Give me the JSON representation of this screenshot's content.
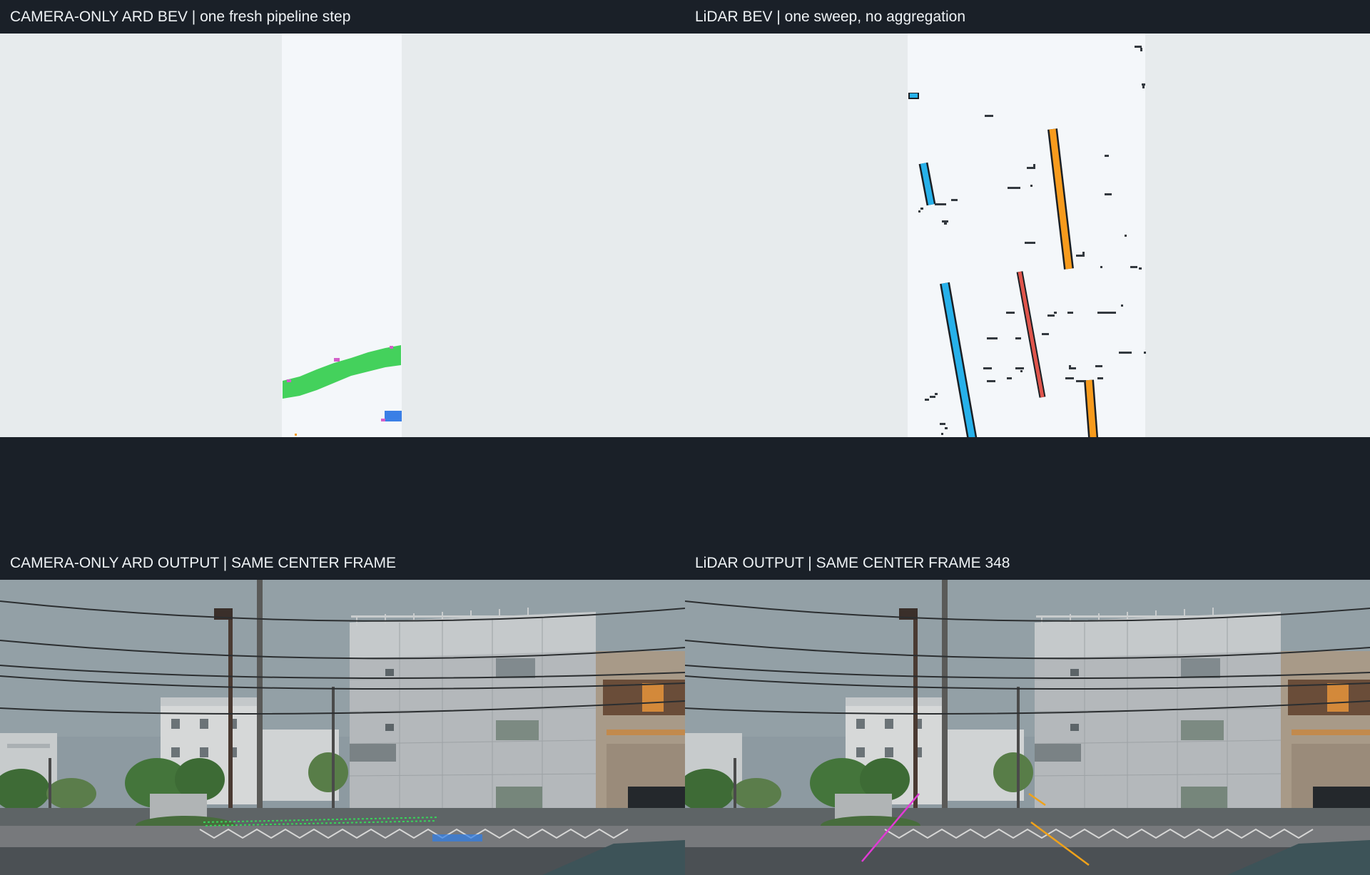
{
  "panels": {
    "camera_bev": {
      "title": "CAMERA-ONLY ARD BEV | one fresh pipeline step",
      "colors": {
        "outer": "#e7ebed",
        "inner": "#f4f7fa",
        "lane_green": "#44d15c",
        "box_blue": "#3a7fe6",
        "marker_orange": "#f39a1c",
        "marker_magenta": "#d35fc9"
      }
    },
    "lidar_bev": {
      "title": "LiDAR BEV | one sweep, no aggregation",
      "colors": {
        "outer": "#e7ebed",
        "inner": "#f4f7fa",
        "blue": "#27b1ea",
        "orange": "#f79b1d",
        "red": "#e0554c",
        "points": "#33393f"
      }
    },
    "camera_output": {
      "title": "CAMERA-ONLY ARD OUTPUT | SAME CENTER FRAME",
      "overlay_colors": {
        "lane": "#39d45a",
        "crosswalk": "#2e7de8"
      }
    },
    "lidar_output": {
      "title": "LiDAR OUTPUT | SAME CENTER FRAME 348",
      "overlay_colors": {
        "magenta": "#e23ad6",
        "orange": "#f0a21a"
      }
    }
  },
  "icons": [
    "street-scene-photo"
  ]
}
